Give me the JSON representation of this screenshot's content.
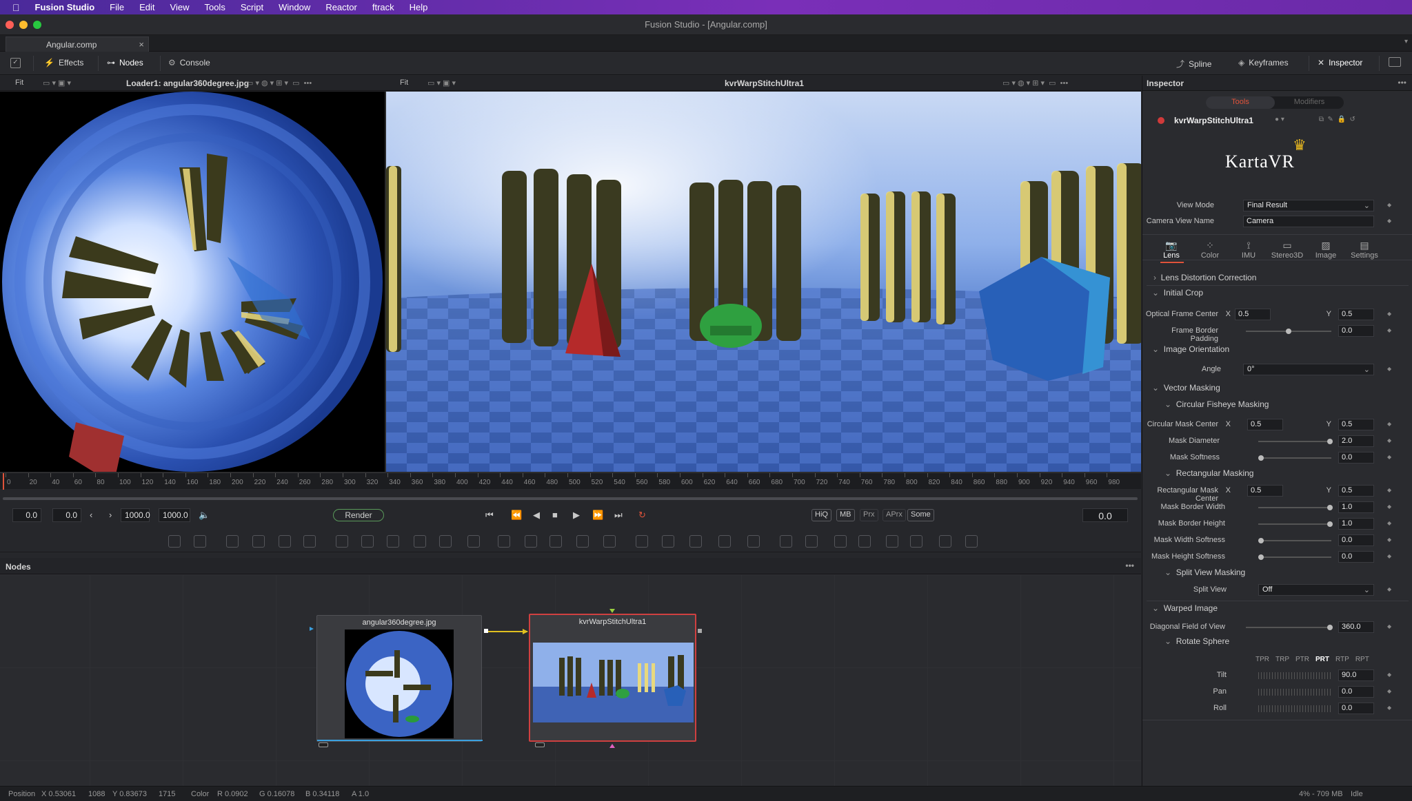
{
  "menubar": {
    "apple": "",
    "items": [
      "Fusion Studio",
      "File",
      "Edit",
      "View",
      "Tools",
      "Script",
      "Window",
      "Reactor",
      "ftrack",
      "Help"
    ]
  },
  "window": {
    "title": "Fusion Studio - [Angular.comp]",
    "tab": "Angular.comp"
  },
  "toolbar": {
    "effects": "Effects",
    "nodes": "Nodes",
    "console": "Console",
    "spline": "Spline",
    "keyframes": "Keyframes",
    "inspector": "Inspector"
  },
  "viewer_left": {
    "fit": "Fit",
    "title": "Loader1: angular360degree.jpg"
  },
  "viewer_right": {
    "fit": "Fit",
    "title": "kvrWarpStitchUltra1"
  },
  "ruler": {
    "ticks": [
      "0",
      "20",
      "40",
      "60",
      "80",
      "100",
      "120",
      "140",
      "160",
      "180",
      "200",
      "220",
      "240",
      "260",
      "280",
      "300",
      "320",
      "340",
      "360",
      "380",
      "400",
      "420",
      "440",
      "460",
      "480",
      "500",
      "520",
      "540",
      "560",
      "580",
      "600",
      "620",
      "640",
      "660",
      "680",
      "700",
      "720",
      "740",
      "760",
      "780",
      "800",
      "820",
      "840",
      "860",
      "880",
      "900",
      "920",
      "940",
      "960",
      "980"
    ]
  },
  "transport": {
    "start": "0.0",
    "current": "0.0",
    "end": "1000.0",
    "global_end": "1000.0",
    "render": "Render",
    "hiq": "HiQ",
    "mb": "MB",
    "prx": "Prx",
    "aprx": "APrx",
    "some": "Some",
    "time": "0.0"
  },
  "nodes": {
    "header": "Nodes",
    "loader": "angular360degree.jpg",
    "warp": "kvrWarpStitchUltra1"
  },
  "status": {
    "position": "Position",
    "x": "X 0.53061",
    "xpx": "1088",
    "y": "Y 0.83673",
    "ypx": "1715",
    "color": "Color",
    "r": "R 0.0902",
    "g": "G 0.16078",
    "b": "B 0.34118",
    "a": "A 1.0",
    "mem": "4% - 709 MB",
    "state": "Idle"
  },
  "inspector": {
    "header": "Inspector",
    "tabs": {
      "tools": "Tools",
      "modifiers": "Modifiers"
    },
    "node_name": "kvrWarpStitchUltra1",
    "logo": "KartaVR",
    "view_mode_label": "View Mode",
    "view_mode": "Final Result",
    "camera_view_name_label": "Camera View Name",
    "camera_view_name": "Camera",
    "subtabs": [
      "Lens",
      "Color",
      "IMU",
      "Stereo3D",
      "Image",
      "Settings"
    ],
    "lens_distortion": "Lens Distortion Correction",
    "initial_crop": "Initial Crop",
    "optical_frame_center": "Optical Frame Center",
    "ofc_x": "0.5",
    "ofc_y": "0.5",
    "frame_border_padding": "Frame Border Padding",
    "fbp": "0.0",
    "image_orientation": "Image Orientation",
    "angle_label": "Angle",
    "angle": "0°",
    "vector_masking": "Vector Masking",
    "circular_fisheye": "Circular Fisheye Masking",
    "circular_mask_center": "Circular Mask Center",
    "cmc_x": "0.5",
    "cmc_y": "0.5",
    "mask_diameter": "Mask Diameter",
    "md": "2.0",
    "mask_softness": "Mask Softness",
    "ms": "0.0",
    "rectangular_masking": "Rectangular Masking",
    "rect_mask_center": "Rectangular Mask Center",
    "rmc_x": "0.5",
    "rmc_y": "0.5",
    "mask_border_width": "Mask Border Width",
    "mbw": "1.0",
    "mask_border_height": "Mask Border Height",
    "mbh": "1.0",
    "mask_width_softness": "Mask Width Softness",
    "mws": "0.0",
    "mask_height_softness": "Mask Height Softness",
    "mhs": "0.0",
    "split_view_masking": "Split View Masking",
    "split_view_label": "Split View",
    "split_view": "Off",
    "warped_image": "Warped Image",
    "dfov_label": "Diagonal Field of View",
    "dfov": "360.0",
    "rotate_sphere": "Rotate Sphere",
    "rot_orders": [
      "TPR",
      "TRP",
      "PTR",
      "PRT",
      "RTP",
      "RPT"
    ],
    "tilt_label": "Tilt",
    "tilt": "90.0",
    "pan_label": "Pan",
    "pan": "0.0",
    "roll_label": "Roll",
    "roll": "0.0",
    "x": "X",
    "y": "Y"
  }
}
